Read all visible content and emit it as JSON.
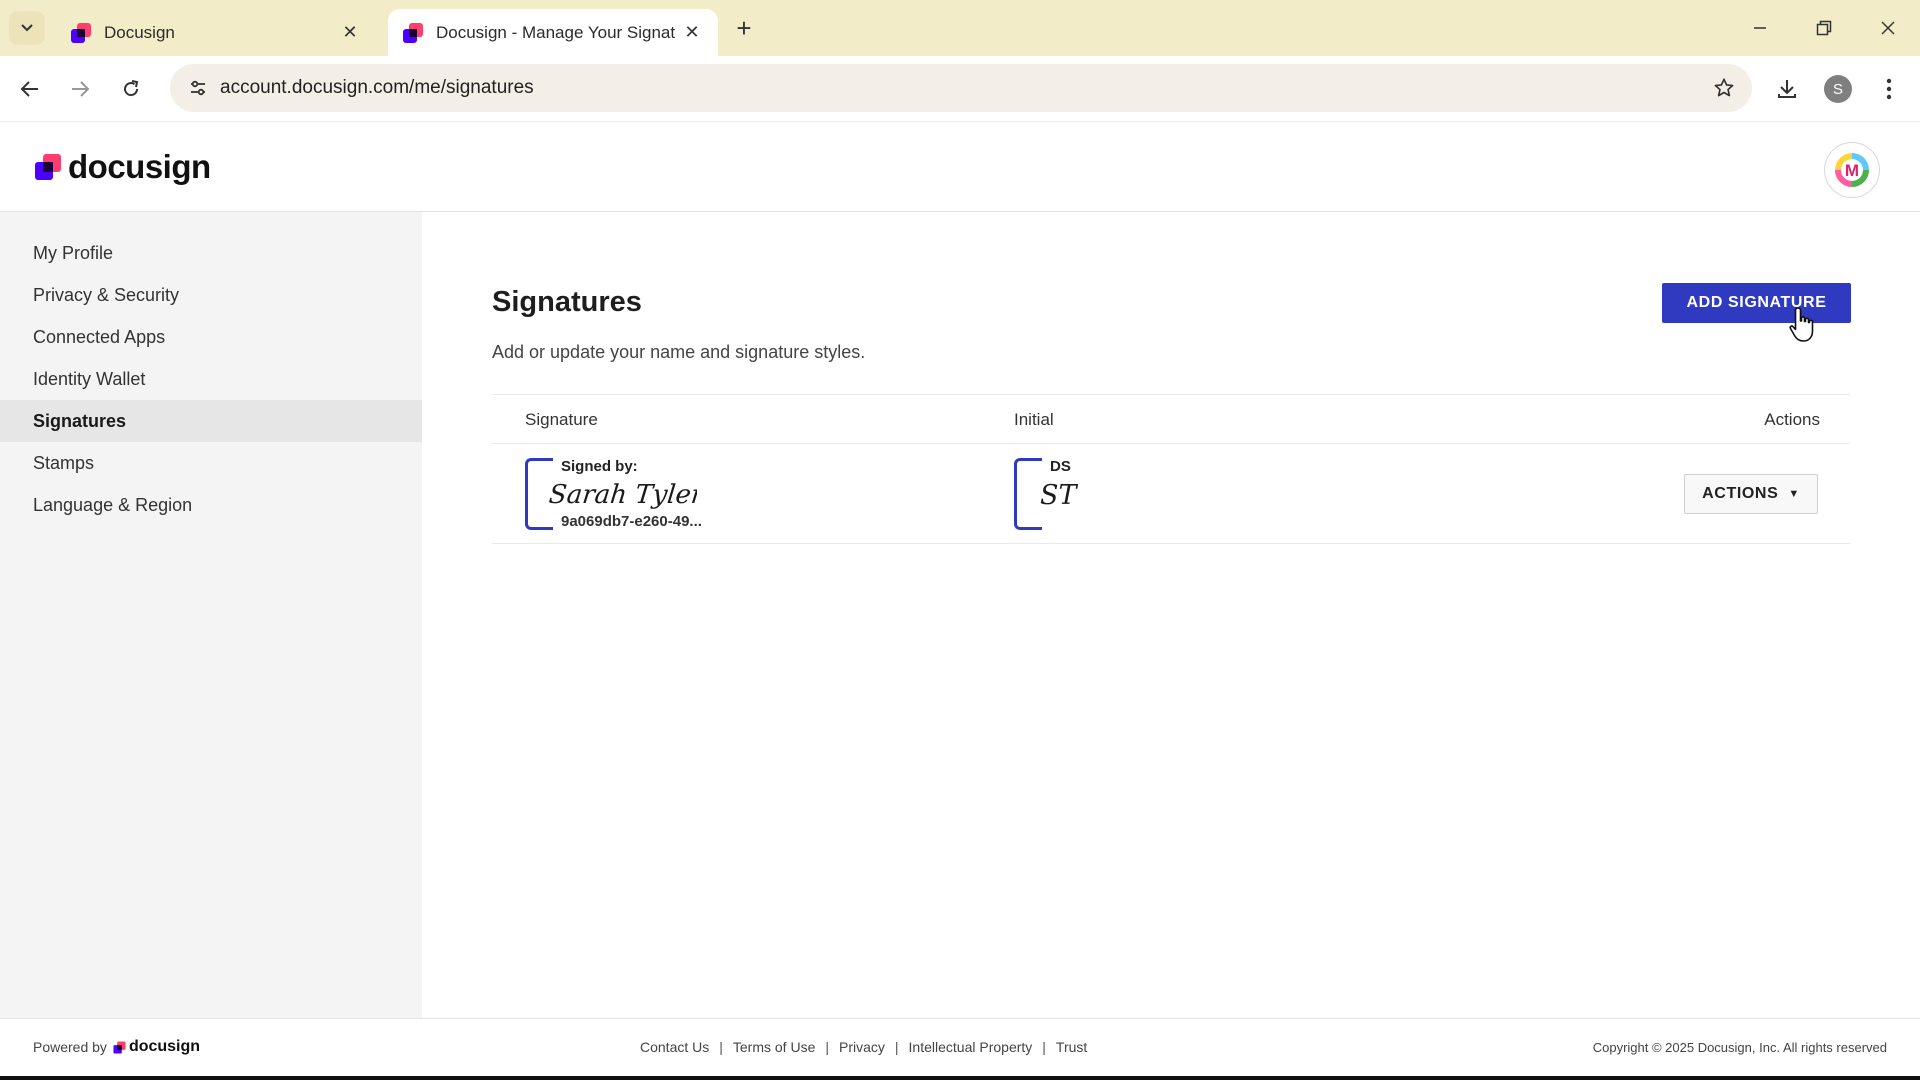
{
  "browser": {
    "tabs": [
      {
        "title": "Docusign",
        "active": false
      },
      {
        "title": "Docusign - Manage Your Signat",
        "active": true
      }
    ],
    "url": "account.docusign.com/me/signatures",
    "profile_initial": "S"
  },
  "header": {
    "logo_text": "docusign",
    "avatar_initial": "M"
  },
  "sidebar": {
    "items": [
      {
        "label": "My Profile",
        "active": false
      },
      {
        "label": "Privacy & Security",
        "active": false
      },
      {
        "label": "Connected Apps",
        "active": false
      },
      {
        "label": "Identity Wallet",
        "active": false
      },
      {
        "label": "Signatures",
        "active": true
      },
      {
        "label": "Stamps",
        "active": false
      },
      {
        "label": "Language & Region",
        "active": false
      }
    ]
  },
  "main": {
    "title": "Signatures",
    "subtitle": "Add or update your name and signature styles.",
    "add_button": "ADD SIGNATURE",
    "table": {
      "columns": [
        "Signature",
        "Initial",
        "Actions"
      ],
      "rows": [
        {
          "signature_label": "Signed by:",
          "signature_name": "Sarah Tyler",
          "signature_id": "9a069db7-e260-49...",
          "initial_label": "DS",
          "initial_text": "ST",
          "actions_label": "ACTIONS"
        }
      ]
    }
  },
  "footer": {
    "powered_by": "Powered by",
    "logo_text": "docusign",
    "links": [
      "Contact Us",
      "Terms of Use",
      "Privacy",
      "Intellectual Property",
      "Trust"
    ],
    "copyright": "Copyright © 2025 Docusign, Inc. All rights reserved"
  },
  "colors": {
    "accent": "#2f3ac1",
    "tabbar": "#f3ecc9",
    "sidebar_bg": "#f4f4f4"
  }
}
